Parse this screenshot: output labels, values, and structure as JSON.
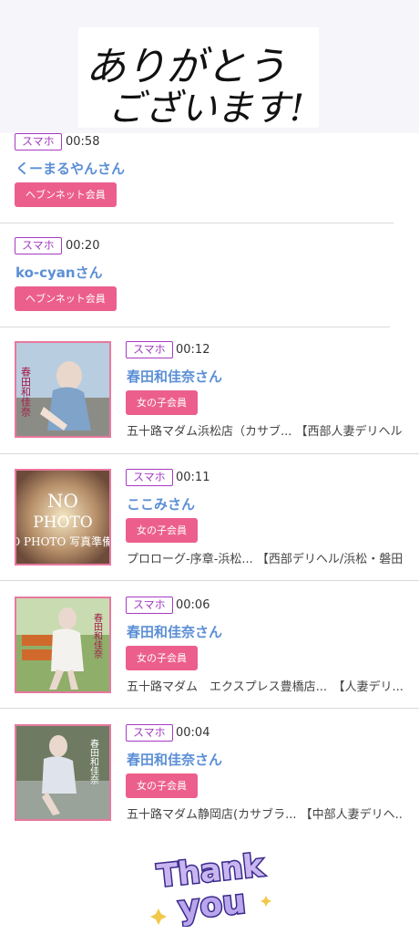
{
  "banner": {
    "text_line1": "ありがとう",
    "text_line2": "ございます!"
  },
  "visits": [
    {
      "device": "スマホ",
      "time": "00:58",
      "name": "くーまるやんさん",
      "member": "ヘブンネット会員",
      "shop": "",
      "has_photo": false
    },
    {
      "device": "スマホ",
      "time": "00:20",
      "name": "ko-cyanさん",
      "member": "ヘブンネット会員",
      "shop": "",
      "has_photo": false
    },
    {
      "device": "スマホ",
      "time": "00:12",
      "name": "春田和佳奈さん",
      "member": "女の子会員",
      "shop": "五十路マダム浜松店（カサブ... 【西部人妻デリヘル...",
      "has_photo": true,
      "photo_caption": "春田和佳奈"
    },
    {
      "device": "スマホ",
      "time": "00:11",
      "name": "ここみさん",
      "member": "女の子会員",
      "shop": "プロローグ-序章-浜松... 【西部デリヘル/浜松・磐田...",
      "has_photo": true,
      "photo_caption": "NO PHOTO 写真準備中"
    },
    {
      "device": "スマホ",
      "time": "00:06",
      "name": "春田和佳奈さん",
      "member": "女の子会員",
      "shop": "五十路マダム　エクスプレス豊橋店...　【人妻デリ...",
      "has_photo": true,
      "photo_caption": "春田和佳奈"
    },
    {
      "device": "スマホ",
      "time": "00:04",
      "name": "春田和佳奈さん",
      "member": "女の子会員",
      "shop": "五十路マダム静岡店(カサブラ... 【中部人妻デリヘ...",
      "has_photo": true,
      "photo_caption": "春田和佳奈"
    }
  ],
  "footer": {
    "text_line1": "Thank",
    "text_line2": "you"
  },
  "colors": {
    "accent_pink": "#ec5f8c",
    "name_blue": "#5b8fd6",
    "badge_purple": "#a53bc2",
    "thumb_border": "#e8789f"
  }
}
